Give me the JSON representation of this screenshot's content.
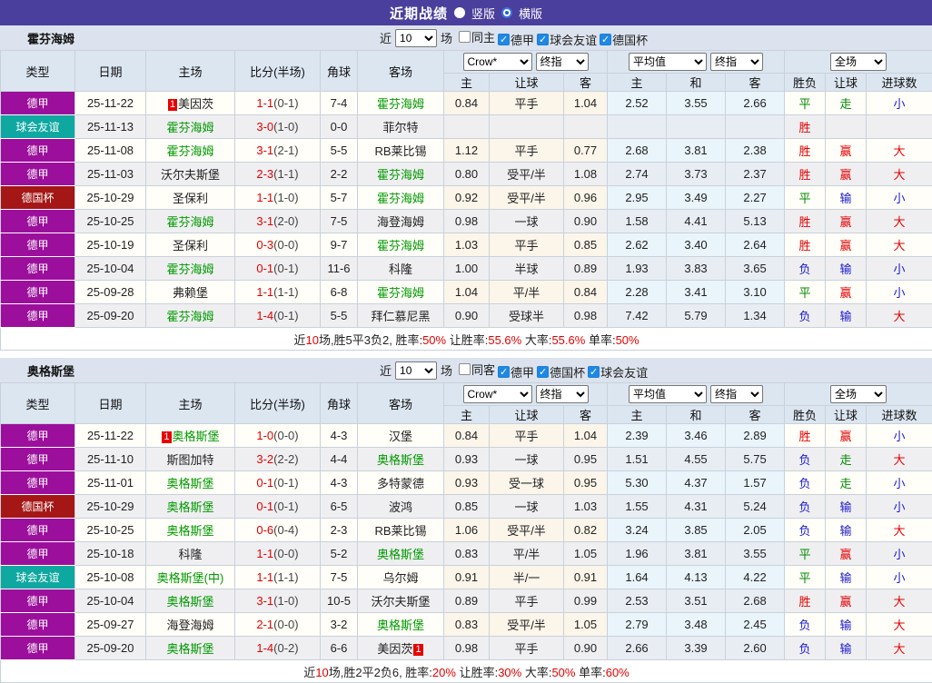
{
  "titlebar": {
    "title": "近期战绩",
    "options": [
      {
        "label": "竖版"
      },
      {
        "label": "横版"
      }
    ]
  },
  "labels": {
    "near": "近",
    "games": "场",
    "crow": "Crow*",
    "final": "终指",
    "avg": "平均值",
    "full": "全场"
  },
  "columns": [
    "类型",
    "日期",
    "主场",
    "比分(半场)",
    "角球",
    "客场"
  ],
  "sub_columns": [
    "主",
    "让球",
    "客",
    "主",
    "和",
    "客",
    "胜负",
    "让球",
    "进球数"
  ],
  "league_colors": {
    "德甲": "#9c0f9c",
    "球会友谊": "#0fa8a0",
    "德国杯": "#a51616"
  },
  "result_colors": {
    "胜": "#e60000",
    "平": "#008a00",
    "负": "#1a1ad0",
    "赢": "#e60000",
    "走": "#008a00",
    "输": "#1a1ad0",
    "大": "#e60000",
    "小": "#1a1ad0"
  },
  "accent_blue": "#1e88e5",
  "tables": [
    {
      "team": "霍芬海姆",
      "filters": {
        "count": "10",
        "checkboxes": [
          {
            "label": "同主",
            "checked": false
          },
          {
            "label": "德甲",
            "checked": true
          },
          {
            "label": "球会友谊",
            "checked": true
          },
          {
            "label": "德国杯",
            "checked": true
          }
        ]
      },
      "rows": [
        {
          "type": "德甲",
          "date": "25-11-22",
          "home": "美因茨",
          "home_green": false,
          "home_badge": "1",
          "score": "1-1",
          "half": "(0-1)",
          "corners": "7-4",
          "away": "霍芬海姆",
          "away_green": true,
          "away_badge": "",
          "odds": [
            "0.84",
            "平手",
            "1.04"
          ],
          "avg": [
            "2.52",
            "3.55",
            "2.66"
          ],
          "results": [
            "平",
            "走",
            "小"
          ]
        },
        {
          "type": "球会友谊",
          "date": "25-11-13",
          "home": "霍芬海姆",
          "home_green": true,
          "home_badge": "",
          "score": "3-0",
          "half": "(1-0)",
          "corners": "0-0",
          "away": "菲尔特",
          "away_green": false,
          "away_badge": "",
          "odds": [
            "",
            "",
            ""
          ],
          "avg": [
            "",
            "",
            ""
          ],
          "results": [
            "胜",
            "",
            ""
          ]
        },
        {
          "type": "德甲",
          "date": "25-11-08",
          "home": "霍芬海姆",
          "home_green": true,
          "home_badge": "",
          "score": "3-1",
          "half": "(2-1)",
          "corners": "5-5",
          "away": "RB莱比锡",
          "away_green": false,
          "away_badge": "",
          "odds": [
            "1.12",
            "平手",
            "0.77"
          ],
          "avg": [
            "2.68",
            "3.81",
            "2.38"
          ],
          "results": [
            "胜",
            "赢",
            "大"
          ]
        },
        {
          "type": "德甲",
          "date": "25-11-03",
          "home": "沃尔夫斯堡",
          "home_green": false,
          "home_badge": "",
          "score": "2-3",
          "half": "(1-1)",
          "corners": "2-2",
          "away": "霍芬海姆",
          "away_green": true,
          "away_badge": "",
          "odds": [
            "0.80",
            "受平/半",
            "1.08"
          ],
          "avg": [
            "2.74",
            "3.73",
            "2.37"
          ],
          "results": [
            "胜",
            "赢",
            "大"
          ]
        },
        {
          "type": "德国杯",
          "date": "25-10-29",
          "home": "圣保利",
          "home_green": false,
          "home_badge": "",
          "score": "1-1",
          "half": "(1-0)",
          "corners": "5-7",
          "away": "霍芬海姆",
          "away_green": true,
          "away_badge": "",
          "odds": [
            "0.92",
            "受平/半",
            "0.96"
          ],
          "avg": [
            "2.95",
            "3.49",
            "2.27"
          ],
          "results": [
            "平",
            "输",
            "小"
          ]
        },
        {
          "type": "德甲",
          "date": "25-10-25",
          "home": "霍芬海姆",
          "home_green": true,
          "home_badge": "",
          "score": "3-1",
          "half": "(2-0)",
          "corners": "7-5",
          "away": "海登海姆",
          "away_green": false,
          "away_badge": "",
          "odds": [
            "0.98",
            "一球",
            "0.90"
          ],
          "avg": [
            "1.58",
            "4.41",
            "5.13"
          ],
          "results": [
            "胜",
            "赢",
            "大"
          ]
        },
        {
          "type": "德甲",
          "date": "25-10-19",
          "home": "圣保利",
          "home_green": false,
          "home_badge": "",
          "score": "0-3",
          "half": "(0-0)",
          "corners": "9-7",
          "away": "霍芬海姆",
          "away_green": true,
          "away_badge": "",
          "odds": [
            "1.03",
            "平手",
            "0.85"
          ],
          "avg": [
            "2.62",
            "3.40",
            "2.64"
          ],
          "results": [
            "胜",
            "赢",
            "大"
          ]
        },
        {
          "type": "德甲",
          "date": "25-10-04",
          "home": "霍芬海姆",
          "home_green": true,
          "home_badge": "",
          "score": "0-1",
          "half": "(0-1)",
          "corners": "11-6",
          "away": "科隆",
          "away_green": false,
          "away_badge": "",
          "odds": [
            "1.00",
            "半球",
            "0.89"
          ],
          "avg": [
            "1.93",
            "3.83",
            "3.65"
          ],
          "results": [
            "负",
            "输",
            "小"
          ]
        },
        {
          "type": "德甲",
          "date": "25-09-28",
          "home": "弗赖堡",
          "home_green": false,
          "home_badge": "",
          "score": "1-1",
          "half": "(1-1)",
          "corners": "6-8",
          "away": "霍芬海姆",
          "away_green": true,
          "away_badge": "",
          "odds": [
            "1.04",
            "平/半",
            "0.84"
          ],
          "avg": [
            "2.28",
            "3.41",
            "3.10"
          ],
          "results": [
            "平",
            "赢",
            "小"
          ]
        },
        {
          "type": "德甲",
          "date": "25-09-20",
          "home": "霍芬海姆",
          "home_green": true,
          "home_badge": "",
          "score": "1-4",
          "half": "(0-1)",
          "corners": "5-5",
          "away": "拜仁慕尼黑",
          "away_green": false,
          "away_badge": "",
          "odds": [
            "0.90",
            "受球半",
            "0.98"
          ],
          "avg": [
            "7.42",
            "5.79",
            "1.34"
          ],
          "results": [
            "负",
            "输",
            "大"
          ]
        }
      ],
      "summary": [
        {
          "t": "近"
        },
        {
          "t": "10",
          "r": true
        },
        {
          "t": "场,胜5平3负2, 胜率:"
        },
        {
          "t": "50%",
          "r": true
        },
        {
          "t": " 让胜率:"
        },
        {
          "t": "55.6%",
          "r": true
        },
        {
          "t": " 大率:"
        },
        {
          "t": "55.6%",
          "r": true
        },
        {
          "t": " 单率:"
        },
        {
          "t": "50%",
          "r": true
        }
      ]
    },
    {
      "team": "奥格斯堡",
      "filters": {
        "count": "10",
        "checkboxes": [
          {
            "label": "同客",
            "checked": false
          },
          {
            "label": "德甲",
            "checked": true
          },
          {
            "label": "德国杯",
            "checked": true
          },
          {
            "label": "球会友谊",
            "checked": true
          }
        ]
      },
      "rows": [
        {
          "type": "德甲",
          "date": "25-11-22",
          "home": "奥格斯堡",
          "home_green": true,
          "home_badge": "1",
          "score": "1-0",
          "half": "(0-0)",
          "corners": "4-3",
          "away": "汉堡",
          "away_green": false,
          "away_badge": "",
          "odds": [
            "0.84",
            "平手",
            "1.04"
          ],
          "avg": [
            "2.39",
            "3.46",
            "2.89"
          ],
          "results": [
            "胜",
            "赢",
            "小"
          ]
        },
        {
          "type": "德甲",
          "date": "25-11-10",
          "home": "斯图加特",
          "home_green": false,
          "home_badge": "",
          "score": "3-2",
          "half": "(2-2)",
          "corners": "4-4",
          "away": "奥格斯堡",
          "away_green": true,
          "away_badge": "",
          "odds": [
            "0.93",
            "一球",
            "0.95"
          ],
          "avg": [
            "1.51",
            "4.55",
            "5.75"
          ],
          "results": [
            "负",
            "走",
            "大"
          ]
        },
        {
          "type": "德甲",
          "date": "25-11-01",
          "home": "奥格斯堡",
          "home_green": true,
          "home_badge": "",
          "score": "0-1",
          "half": "(0-1)",
          "corners": "4-3",
          "away": "多特蒙德",
          "away_green": false,
          "away_badge": "",
          "odds": [
            "0.93",
            "受一球",
            "0.95"
          ],
          "avg": [
            "5.30",
            "4.37",
            "1.57"
          ],
          "results": [
            "负",
            "走",
            "小"
          ]
        },
        {
          "type": "德国杯",
          "date": "25-10-29",
          "home": "奥格斯堡",
          "home_green": true,
          "home_badge": "",
          "score": "0-1",
          "half": "(0-1)",
          "corners": "6-5",
          "away": "波鸿",
          "away_green": false,
          "away_badge": "",
          "odds": [
            "0.85",
            "一球",
            "1.03"
          ],
          "avg": [
            "1.55",
            "4.31",
            "5.24"
          ],
          "results": [
            "负",
            "输",
            "小"
          ]
        },
        {
          "type": "德甲",
          "date": "25-10-25",
          "home": "奥格斯堡",
          "home_green": true,
          "home_badge": "",
          "score": "0-6",
          "half": "(0-4)",
          "corners": "2-3",
          "away": "RB莱比锡",
          "away_green": false,
          "away_badge": "",
          "odds": [
            "1.06",
            "受平/半",
            "0.82"
          ],
          "avg": [
            "3.24",
            "3.85",
            "2.05"
          ],
          "results": [
            "负",
            "输",
            "大"
          ]
        },
        {
          "type": "德甲",
          "date": "25-10-18",
          "home": "科隆",
          "home_green": false,
          "home_badge": "",
          "score": "1-1",
          "half": "(0-0)",
          "corners": "5-2",
          "away": "奥格斯堡",
          "away_green": true,
          "away_badge": "",
          "odds": [
            "0.83",
            "平/半",
            "1.05"
          ],
          "avg": [
            "1.96",
            "3.81",
            "3.55"
          ],
          "results": [
            "平",
            "赢",
            "小"
          ]
        },
        {
          "type": "球会友谊",
          "date": "25-10-08",
          "home": "奥格斯堡(中)",
          "home_green": true,
          "home_badge": "",
          "score": "1-1",
          "half": "(1-1)",
          "corners": "7-5",
          "away": "乌尔姆",
          "away_green": false,
          "away_badge": "",
          "odds": [
            "0.91",
            "半/一",
            "0.91"
          ],
          "avg": [
            "1.64",
            "4.13",
            "4.22"
          ],
          "results": [
            "平",
            "输",
            "小"
          ]
        },
        {
          "type": "德甲",
          "date": "25-10-04",
          "home": "奥格斯堡",
          "home_green": true,
          "home_badge": "",
          "score": "3-1",
          "half": "(1-0)",
          "corners": "10-5",
          "away": "沃尔夫斯堡",
          "away_green": false,
          "away_badge": "",
          "odds": [
            "0.89",
            "平手",
            "0.99"
          ],
          "avg": [
            "2.53",
            "3.51",
            "2.68"
          ],
          "results": [
            "胜",
            "赢",
            "大"
          ]
        },
        {
          "type": "德甲",
          "date": "25-09-27",
          "home": "海登海姆",
          "home_green": false,
          "home_badge": "",
          "score": "2-1",
          "half": "(0-0)",
          "corners": "3-2",
          "away": "奥格斯堡",
          "away_green": true,
          "away_badge": "",
          "odds": [
            "0.83",
            "受平/半",
            "1.05"
          ],
          "avg": [
            "2.79",
            "3.48",
            "2.45"
          ],
          "results": [
            "负",
            "输",
            "大"
          ]
        },
        {
          "type": "德甲",
          "date": "25-09-20",
          "home": "奥格斯堡",
          "home_green": true,
          "home_badge": "",
          "score": "1-4",
          "half": "(0-2)",
          "corners": "6-6",
          "away": "美因茨",
          "away_green": false,
          "away_badge": "1",
          "odds": [
            "0.98",
            "平手",
            "0.90"
          ],
          "avg": [
            "2.66",
            "3.39",
            "2.60"
          ],
          "results": [
            "负",
            "输",
            "大"
          ]
        }
      ],
      "summary": [
        {
          "t": "近"
        },
        {
          "t": "10",
          "r": true
        },
        {
          "t": "场,胜2平2负6, 胜率:"
        },
        {
          "t": "20%",
          "r": true
        },
        {
          "t": " 让胜率:"
        },
        {
          "t": "30%",
          "r": true
        },
        {
          "t": " 大率:"
        },
        {
          "t": "50%",
          "r": true
        },
        {
          "t": " 单率:"
        },
        {
          "t": "60%",
          "r": true
        }
      ]
    }
  ]
}
